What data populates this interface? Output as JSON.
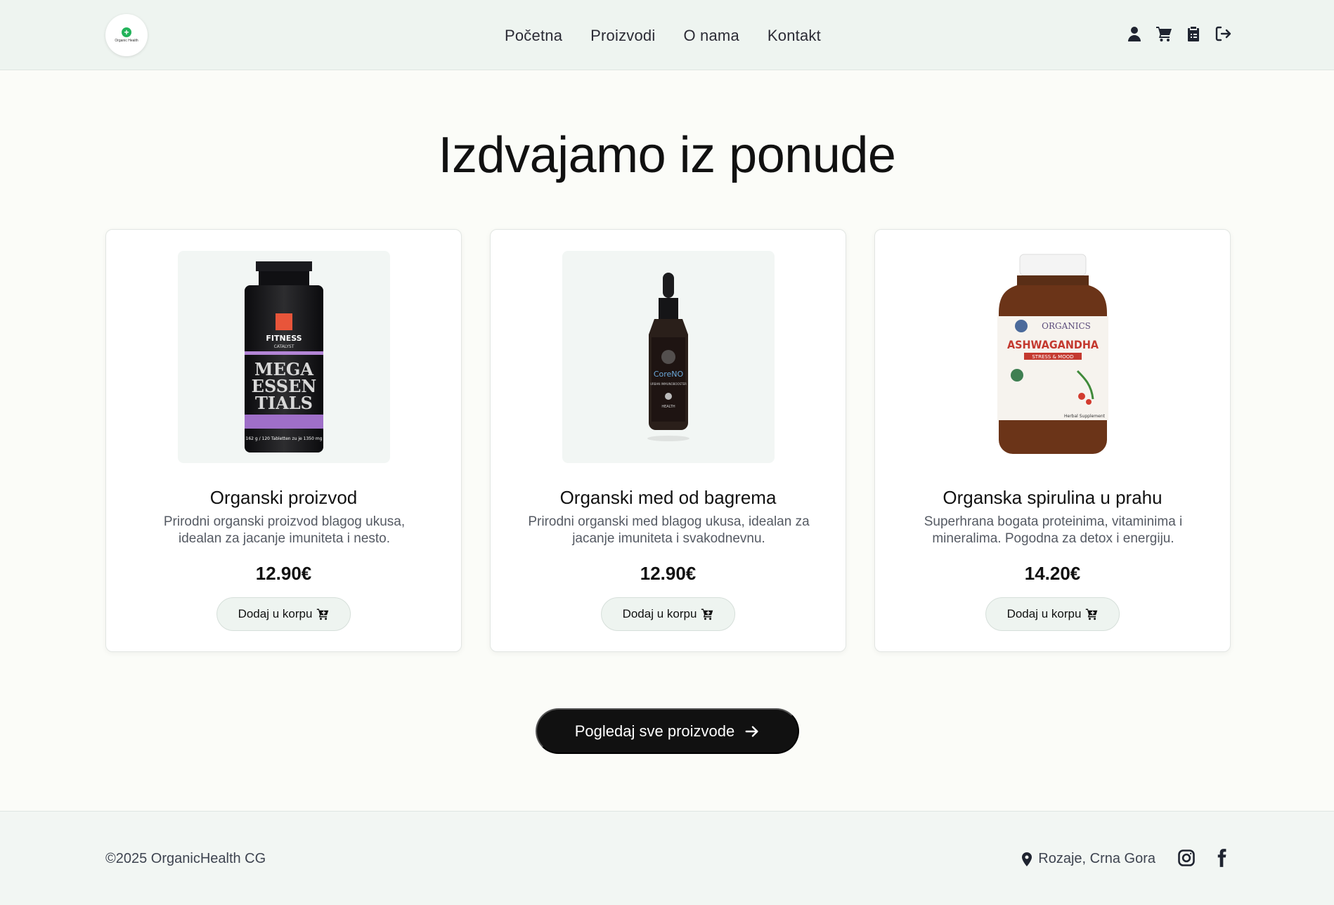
{
  "header": {
    "logo_text": "Organic Health",
    "nav": [
      "Početna",
      "Proizvodi",
      "O nama",
      "Kontakt"
    ],
    "icons": [
      "user-icon",
      "cart-icon",
      "clipboard-icon",
      "logout-icon"
    ]
  },
  "main": {
    "title": "Izdvajamo iz ponude",
    "products": [
      {
        "name": "Organski proizvod",
        "description": "Prirodni organski proizvod blagog ukusa, idealan za jacanje imuniteta i nesto.",
        "price": "12.90€",
        "button": "Dodaj u korpu",
        "image_label_top": "FITNESS",
        "image_label_sub": "CATALYST",
        "image_label_main": "MEGA ESSEN TIALS",
        "image_label_bottom": "162 g / 120 Tabletten zu je 1350 mg"
      },
      {
        "name": "Organski med od bagrema",
        "description": "Prirodni organski med blagog ukusa, idealan za jacanje imuniteta i svakodnevnu.",
        "price": "12.90€",
        "button": "Dodaj u korpu",
        "image_label_main": "CoreNO",
        "image_label_sub": "URBAN IMMUNOBOOSTER",
        "image_label_bottom": "HEALTH"
      },
      {
        "name": "Organska spirulina u prahu",
        "description": "Superhrana bogata proteinima, vitaminima i mineralima. Pogodna za detox i energiju.",
        "price": "14.20€",
        "button": "Dodaj u korpu",
        "image_label_top": "ORGANICS",
        "image_label_main": "ASHWAGANDHA",
        "image_label_sub": "STRESS & MOOD",
        "image_label_bottom": "Herbal Supplement"
      }
    ],
    "view_all": "Pogledaj sve proizvode"
  },
  "footer": {
    "copyright": "©2025 OrganicHealth CG",
    "location": "Rozaje, Crna Gora",
    "social": [
      "instagram-icon",
      "facebook-icon"
    ]
  },
  "colors": {
    "accent": "#22b35a",
    "dark": "#111111",
    "header_bg": "#eef4f0"
  }
}
